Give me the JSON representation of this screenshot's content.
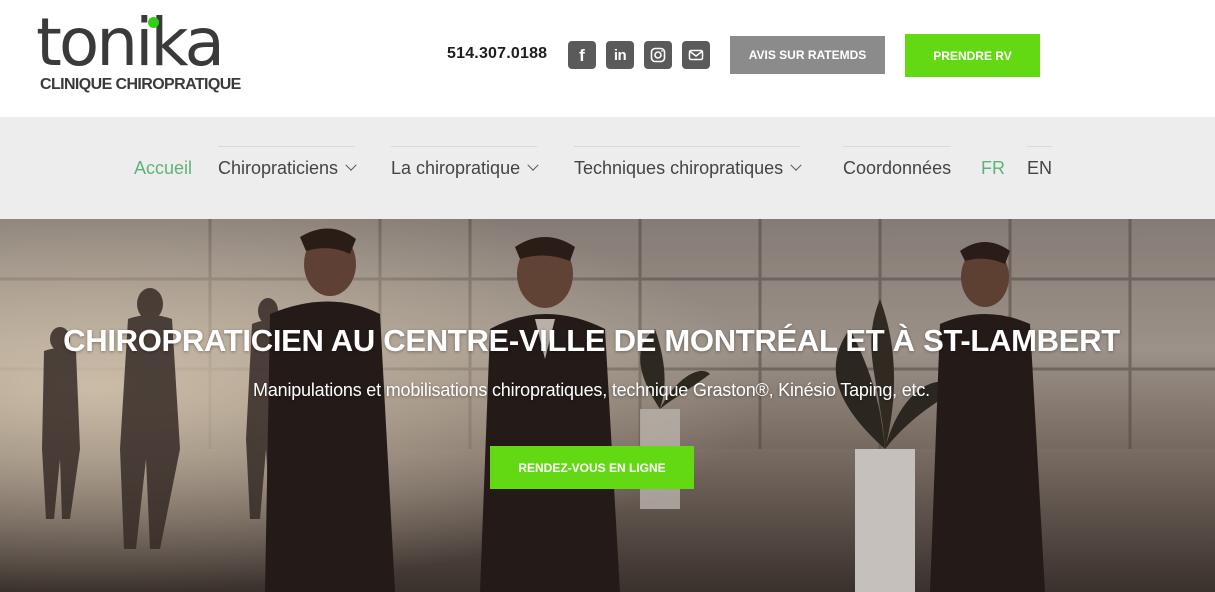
{
  "brand": {
    "name": "tonika",
    "tagline": "CLINIQUE CHIROPRATIQUE",
    "accent_color": "#63d913"
  },
  "header": {
    "phone": "514.307.0188",
    "social": [
      {
        "icon": "facebook-icon",
        "glyph": "f"
      },
      {
        "icon": "linkedin-icon",
        "glyph": "in"
      },
      {
        "icon": "instagram-icon"
      },
      {
        "icon": "email-icon"
      }
    ],
    "ratemds_label": "AVIS SUR RATEMDS",
    "appointment_label": "PRENDRE RV"
  },
  "nav": {
    "items": [
      {
        "label": "Accueil",
        "active": true
      },
      {
        "label": "Chiropraticiens",
        "has_dropdown": true
      },
      {
        "label": "La chiropratique",
        "has_dropdown": true
      },
      {
        "label": "Techniques chiropratiques",
        "has_dropdown": true
      },
      {
        "label": "Coordonnées"
      },
      {
        "label": "FR",
        "active": true
      },
      {
        "label": "EN"
      }
    ]
  },
  "hero": {
    "title": "CHIROPRATICIEN AU CENTRE-VILLE DE MONTRÉAL ET À ST-LAMBERT",
    "subtitle": "Manipulations et mobilisations chiropratiques, technique Graston®, Kinésio Taping, etc.",
    "cta_label": "RENDEZ-VOUS EN LIGNE"
  }
}
